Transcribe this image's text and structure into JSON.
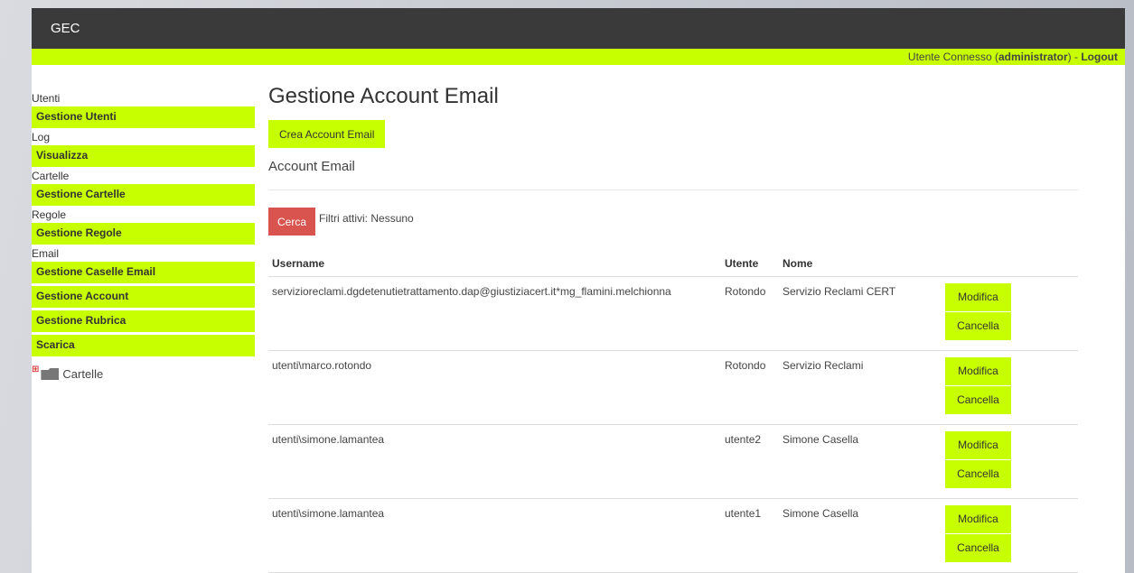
{
  "app": {
    "title": "GEC"
  },
  "userbar": {
    "prefix": "Utente Connesso (",
    "user": "administrator",
    "sep": ") - ",
    "logout": "Logout"
  },
  "sidebar": {
    "sections": [
      {
        "label": "Utenti",
        "items": [
          "Gestione Utenti"
        ]
      },
      {
        "label": "Log",
        "items": [
          "Visualizza"
        ]
      },
      {
        "label": "Cartelle",
        "items": [
          "Gestione Cartelle"
        ]
      },
      {
        "label": "Regole",
        "items": [
          "Gestione Regole"
        ]
      },
      {
        "label": "Email",
        "items": [
          "Gestione Caselle Email",
          "Gestione Account",
          "Gestione Rubrica",
          "Scarica"
        ]
      }
    ],
    "tree_label": "Cartelle"
  },
  "main": {
    "title": "Gestione Account Email",
    "create_button": "Crea Account Email",
    "subtitle": "Account Email",
    "search_button": "Cerca",
    "filters_text": "Filtri attivi: Nessuno",
    "table": {
      "headers": [
        "Username",
        "Utente",
        "Nome"
      ],
      "rows": [
        {
          "username": "servizioreclami.dgdetenutietrattamento.dap@giustiziacert.it*mg_flamini.melchionna",
          "utente": "Rotondo",
          "nome": "Servizio Reclami CERT"
        },
        {
          "username": "utenti\\marco.rotondo",
          "utente": "Rotondo",
          "nome": "Servizio Reclami"
        },
        {
          "username": "utenti\\simone.lamantea",
          "utente": "utente2",
          "nome": "Simone Casella"
        },
        {
          "username": "utenti\\simone.lamantea",
          "utente": "utente1",
          "nome": "Simone Casella"
        }
      ],
      "edit_label": "Modifica",
      "delete_label": "Cancella"
    }
  },
  "colors": {
    "accent": "#c8ff00",
    "topbar": "#3a3a3a",
    "danger": "#d9534f"
  },
  "icons": {
    "tree_expand": "plus-icon",
    "tree_folder": "folder-icon"
  }
}
